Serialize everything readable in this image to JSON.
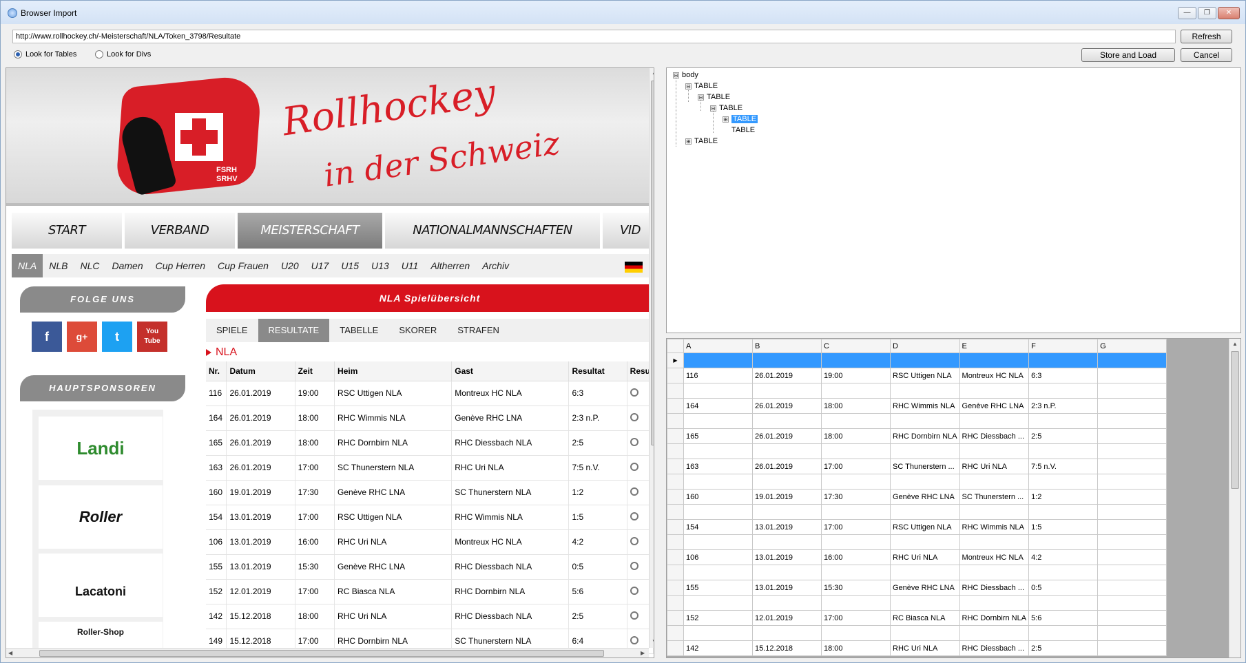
{
  "window": {
    "title": "Browser Import",
    "controls": [
      "—",
      "❐",
      "✕"
    ]
  },
  "url": "http://www.rollhockey.ch/-Meisterschaft/NLA/Token_3798/Resultate",
  "buttons": {
    "refresh": "Refresh",
    "store_and_load": "Store and Load",
    "cancel": "Cancel"
  },
  "radios": {
    "tables": "Look for Tables",
    "divs": "Look for Divs",
    "selected": "tables"
  },
  "site": {
    "banner": {
      "line1": "Rollhockey",
      "line2": "in der Schweiz",
      "badge1": "FSRH",
      "badge2": "SRHV"
    },
    "main_nav": [
      "START",
      "VERBAND",
      "MEISTERSCHAFT",
      "NATIONALMANNSCHAFTEN",
      "VID"
    ],
    "sub_nav": [
      "NLA",
      "NLB",
      "NLC",
      "Damen",
      "Cup Herren",
      "Cup Frauen",
      "U20",
      "U17",
      "U15",
      "U13",
      "U11",
      "Altherren",
      "Archiv"
    ],
    "follow": "FOLGE UNS",
    "social": [
      "f",
      "g+",
      "t",
      "You Tube"
    ],
    "sponsors_title": "HAUPTSPONSOREN",
    "sponsors": [
      "Landi",
      "Roller",
      "Lacatoni",
      "Roller-Shop"
    ],
    "overview_title": "NLA Spielübersicht",
    "result_tabs": [
      "SPIELE",
      "RESULTATE",
      "TABELLE",
      "SKORER",
      "STRAFEN"
    ],
    "league": "NLA",
    "columns": [
      "Nr.",
      "Datum",
      "Zeit",
      "Heim",
      "Gast",
      "Resultat",
      "Resu"
    ],
    "rows": [
      [
        "116",
        "26.01.2019",
        "19:00",
        "RSC Uttigen NLA",
        "Montreux HC NLA",
        "6:3"
      ],
      [
        "164",
        "26.01.2019",
        "18:00",
        "RHC Wimmis NLA",
        "Genève RHC LNA",
        "2:3 n.P."
      ],
      [
        "165",
        "26.01.2019",
        "18:00",
        "RHC Dornbirn NLA",
        "RHC Diessbach NLA",
        "2:5"
      ],
      [
        "163",
        "26.01.2019",
        "17:00",
        "SC Thunerstern NLA",
        "RHC Uri NLA",
        "7:5 n.V."
      ],
      [
        "160",
        "19.01.2019",
        "17:30",
        "Genève RHC LNA",
        "SC Thunerstern NLA",
        "1:2"
      ],
      [
        "154",
        "13.01.2019",
        "17:00",
        "RSC Uttigen NLA",
        "RHC Wimmis NLA",
        "1:5"
      ],
      [
        "106",
        "13.01.2019",
        "16:00",
        "RHC Uri NLA",
        "Montreux HC NLA",
        "4:2"
      ],
      [
        "155",
        "13.01.2019",
        "15:30",
        "Genève RHC LNA",
        "RHC Diessbach NLA",
        "0:5"
      ],
      [
        "152",
        "12.01.2019",
        "17:00",
        "RC Biasca NLA",
        "RHC Dornbirn NLA",
        "5:6"
      ],
      [
        "142",
        "15.12.2018",
        "18:00",
        "RHC Uri NLA",
        "RHC Diessbach NLA",
        "2:5"
      ],
      [
        "149",
        "15.12.2018",
        "17:00",
        "RHC Dornbirn NLA",
        "SC Thunerstern NLA",
        "6:4"
      ]
    ]
  },
  "tree": {
    "nodes": [
      {
        "label": "body",
        "exp": "⊟"
      },
      {
        "label": "TABLE",
        "exp": "⊟"
      },
      {
        "label": "TABLE",
        "exp": "⊟"
      },
      {
        "label": "TABLE",
        "exp": "⊟"
      },
      {
        "label": "TABLE",
        "exp": "⊞"
      },
      {
        "label": "TABLE",
        "exp": ""
      },
      {
        "label": "TABLE",
        "exp": "⊞"
      }
    ]
  },
  "grid": {
    "columns": [
      "A",
      "B",
      "C",
      "D",
      "E",
      "F",
      "G"
    ],
    "rows": [
      [
        "",
        "",
        "",
        "",
        "",
        "",
        ""
      ],
      [
        "116",
        "26.01.2019",
        "19:00",
        "RSC Uttigen NLA",
        "Montreux HC NLA",
        "6:3",
        ""
      ],
      [
        "",
        "",
        "",
        "",
        "",
        "",
        ""
      ],
      [
        "164",
        "26.01.2019",
        "18:00",
        "RHC Wimmis NLA",
        "Genève RHC LNA",
        "2:3 n.P.",
        ""
      ],
      [
        "",
        "",
        "",
        "",
        "",
        "",
        ""
      ],
      [
        "165",
        "26.01.2019",
        "18:00",
        "RHC Dornbirn NLA",
        "RHC Diessbach ...",
        "2:5",
        ""
      ],
      [
        "",
        "",
        "",
        "",
        "",
        "",
        ""
      ],
      [
        "163",
        "26.01.2019",
        "17:00",
        "SC Thunerstern ...",
        "RHC Uri NLA",
        "7:5 n.V.",
        ""
      ],
      [
        "",
        "",
        "",
        "",
        "",
        "",
        ""
      ],
      [
        "160",
        "19.01.2019",
        "17:30",
        "Genève RHC LNA",
        "SC Thunerstern ...",
        "1:2",
        ""
      ],
      [
        "",
        "",
        "",
        "",
        "",
        "",
        ""
      ],
      [
        "154",
        "13.01.2019",
        "17:00",
        "RSC Uttigen NLA",
        "RHC Wimmis NLA",
        "1:5",
        ""
      ],
      [
        "",
        "",
        "",
        "",
        "",
        "",
        ""
      ],
      [
        "106",
        "13.01.2019",
        "16:00",
        "RHC Uri NLA",
        "Montreux HC NLA",
        "4:2",
        ""
      ],
      [
        "",
        "",
        "",
        "",
        "",
        "",
        ""
      ],
      [
        "155",
        "13.01.2019",
        "15:30",
        "Genève RHC LNA",
        "RHC Diessbach ...",
        "0:5",
        ""
      ],
      [
        "",
        "",
        "",
        "",
        "",
        "",
        ""
      ],
      [
        "152",
        "12.01.2019",
        "17:00",
        "RC Biasca NLA",
        "RHC Dornbirn NLA",
        "5:6",
        ""
      ],
      [
        "",
        "",
        "",
        "",
        "",
        "",
        ""
      ],
      [
        "142",
        "15.12.2018",
        "18:00",
        "RHC Uri NLA",
        "RHC Diessbach ...",
        "2:5",
        ""
      ]
    ]
  }
}
